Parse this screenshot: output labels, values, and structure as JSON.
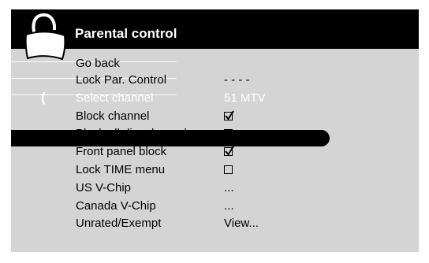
{
  "menu": {
    "title": "Parental control",
    "selected_marker": "(",
    "items": [
      {
        "label": "Go back",
        "value": ""
      },
      {
        "label": "Lock Par. Control",
        "value": "- - - -"
      },
      {
        "label": "Select channel",
        "value": "51 MTV",
        "selected": true
      },
      {
        "label": "Block channel",
        "checked": true
      },
      {
        "label": "Block all dig. channels",
        "checked": false
      },
      {
        "label": "Front panel block",
        "checked": true
      },
      {
        "label": "Lock TIME menu",
        "checked": false
      },
      {
        "label": "US V-Chip",
        "value": "..."
      },
      {
        "label": "Canada V-Chip",
        "value": "..."
      },
      {
        "label": "Unrated/Exempt",
        "value": "View..."
      }
    ]
  },
  "colors": {
    "header": "#000000",
    "body": "#d4d4d4",
    "highlight": "#000000",
    "text": "#000000"
  },
  "icons": {
    "header": "padlock-icon"
  }
}
